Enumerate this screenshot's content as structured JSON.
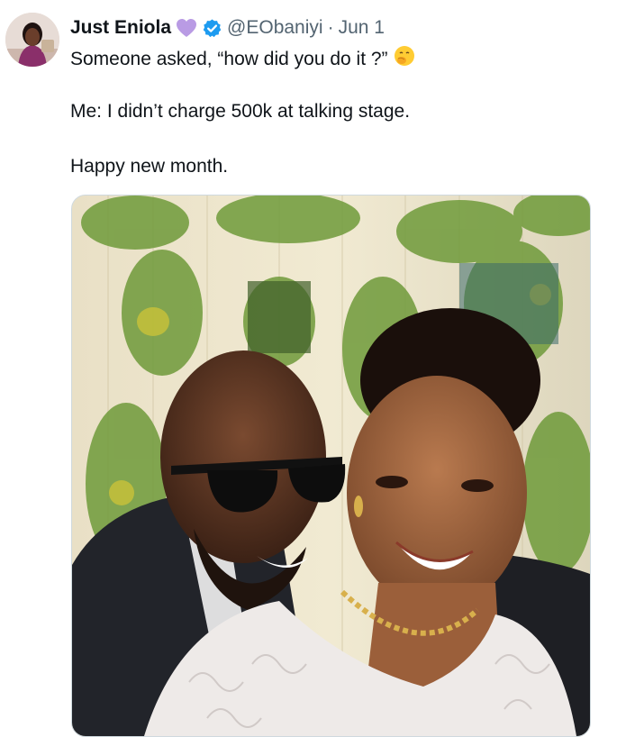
{
  "tweet": {
    "author": {
      "display_name": "Just Eniola",
      "handle": "@EObaniyi",
      "separator": "·",
      "date": "Jun 1"
    },
    "text": {
      "line1": "Someone asked, “how did you do it ?”",
      "line2": "Me: I didn’t charge 500k at talking stage.",
      "line3": "Happy new month."
    },
    "icons": {
      "name_emoji": "purple-heart",
      "verified": "verified-badge",
      "text_emoji": "face-with-hand-over-mouth"
    },
    "colors": {
      "text": "#0f1419",
      "secondary": "#536471",
      "verified": "#1d9bf0",
      "heart": "#b99be4"
    }
  }
}
